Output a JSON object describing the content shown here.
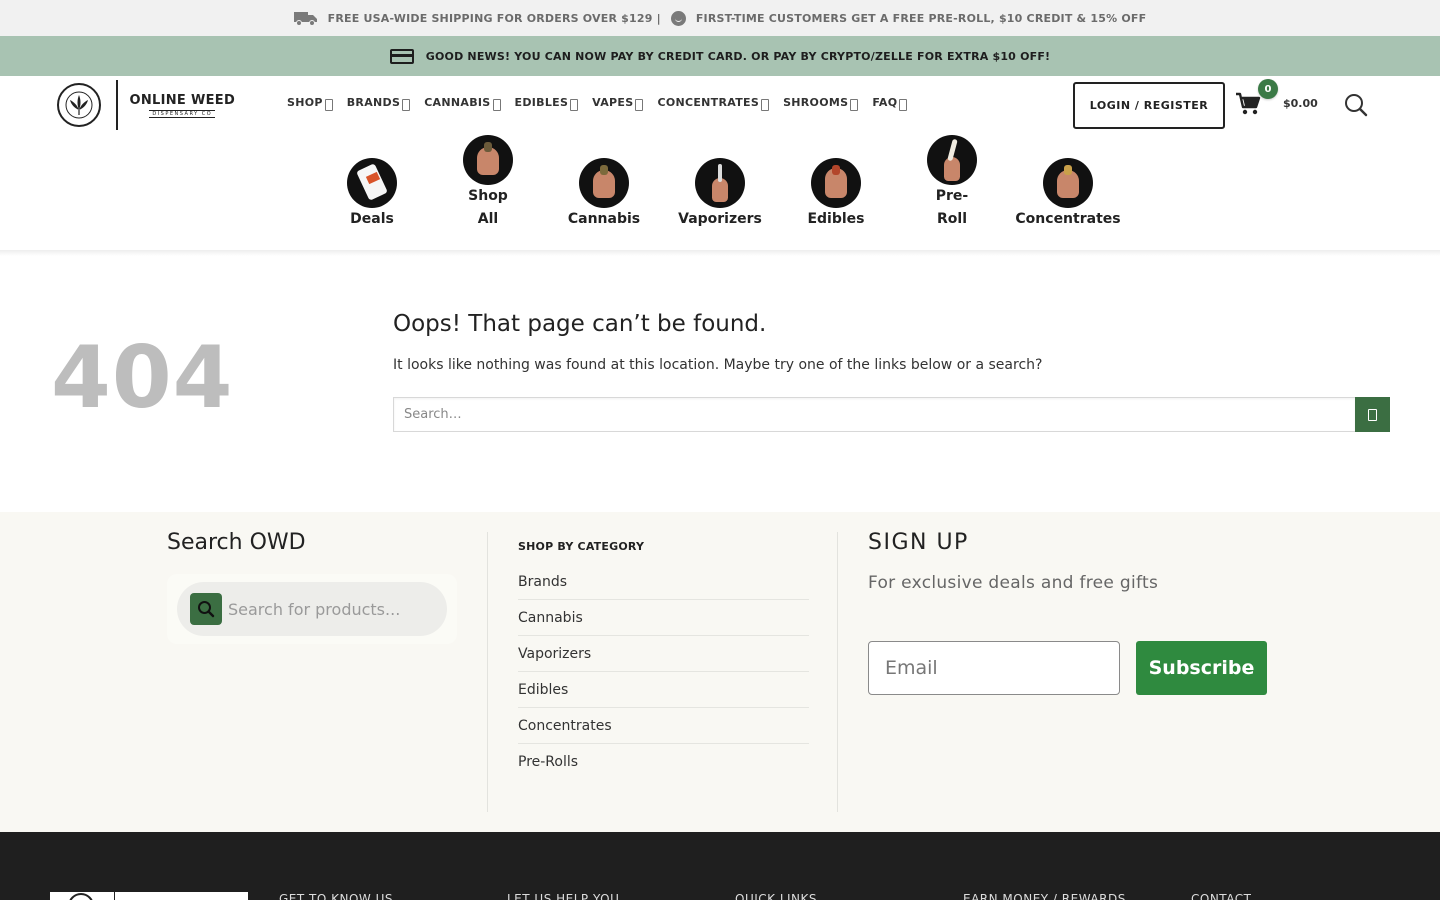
{
  "topbar": {
    "shipping_text": "FREE USA-WIDE SHIPPING FOR ORDERS OVER $129 |",
    "first_time_text": "FIRST-TIME CUSTOMERS GET A FREE PRE-ROLL, $10 CREDIT & 15% OFF"
  },
  "newsbar": {
    "text": "GOOD NEWS! YOU CAN NOW PAY BY CREDIT CARD. OR PAY BY CRYPTO/ZELLE FOR EXTRA $10 OFF!"
  },
  "logo": {
    "line1": "ONLINE WEED",
    "line2": "DISPENSARY CO"
  },
  "nav": [
    {
      "label": "SHOP"
    },
    {
      "label": "BRANDS"
    },
    {
      "label": "CANNABIS"
    },
    {
      "label": "EDIBLES"
    },
    {
      "label": "VAPES"
    },
    {
      "label": "CONCENTRATES"
    },
    {
      "label": "SHROOMS"
    },
    {
      "label": "FAQ"
    }
  ],
  "header": {
    "login_label": "LOGIN / REGISTER",
    "cart_count": "0",
    "cart_total": "$0.00"
  },
  "categories": [
    {
      "line1": "Deals",
      "line2": ""
    },
    {
      "line1": "Shop",
      "line2": "All"
    },
    {
      "line1": "Cannabis",
      "line2": ""
    },
    {
      "line1": "Vaporizers",
      "line2": ""
    },
    {
      "line1": "Edibles",
      "line2": ""
    },
    {
      "line1": "Pre-",
      "line2": "Roll"
    },
    {
      "line1": "Concentrates",
      "line2": ""
    }
  ],
  "error": {
    "code": "404",
    "title": "Oops! That page can’t be found.",
    "message": "It looks like nothing was found at this location. Maybe try one of the links below or a search?",
    "search_placeholder": "Search…"
  },
  "footer": {
    "search_title": "Search OWD",
    "search_placeholder": "Search for products...",
    "category_heading": "SHOP BY CATEGORY",
    "category_links": [
      "Brands",
      "Cannabis",
      "Vaporizers",
      "Edibles",
      "Concentrates",
      "Pre-Rolls"
    ],
    "signup_title": "SIGN UP",
    "signup_subtitle": "For exclusive deals and free gifts",
    "email_placeholder": "Email",
    "subscribe_label": "Subscribe",
    "bottom_columns": [
      "GET TO KNOW US",
      "LET US HELP YOU",
      "QUICK LINKS",
      "EARN MONEY / REWARDS",
      "CONTACT"
    ]
  },
  "colors": {
    "accent_green": "#3b6e42",
    "subscribe_green": "#2f8a3f",
    "news_bar": "#a8c3b2",
    "dark_footer": "#1f1f1f"
  },
  "icons": [
    "truck-icon",
    "smile-icon",
    "credit-card-icon",
    "cannabis-leaf-icon",
    "caret-icon",
    "cart-icon",
    "search-icon"
  ]
}
